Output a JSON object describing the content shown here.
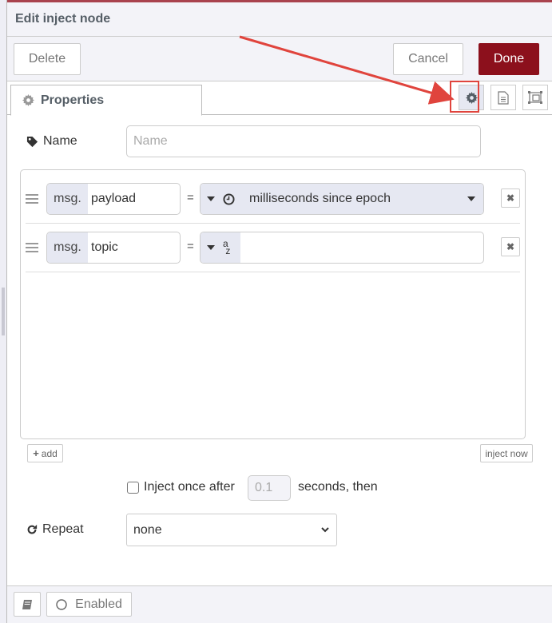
{
  "header": {
    "title": "Edit inject node"
  },
  "toolbar": {
    "delete_label": "Delete",
    "cancel_label": "Cancel",
    "done_label": "Done"
  },
  "tabs": {
    "properties_label": "Properties",
    "icons": [
      "gear-icon",
      "file-text-icon",
      "appearance-icon"
    ],
    "active": "settings"
  },
  "form": {
    "name_label": "Name",
    "name_placeholder": "Name",
    "name_value": "",
    "rules": [
      {
        "prefix": "msg.",
        "property": "payload",
        "operator": "=",
        "type_icon": "clock-icon",
        "type_label": "milliseconds since epoch",
        "value": ""
      },
      {
        "prefix": "msg.",
        "property": "topic",
        "operator": "=",
        "type_icon": "string-az-icon",
        "type_label": "",
        "value": ""
      }
    ],
    "add_label": "add",
    "inject_now_label": "inject now",
    "inject_once_label": "Inject once after",
    "inject_once_checked": false,
    "inject_delay_value": "0.1",
    "inject_delay_suffix": "seconds, then",
    "repeat_label": "Repeat",
    "repeat_value": "none"
  },
  "footer": {
    "enabled_label": "Enabled"
  },
  "colors": {
    "done": "#8c101c",
    "highlight": "#e0443d",
    "accent_bar": "#a9434e"
  }
}
